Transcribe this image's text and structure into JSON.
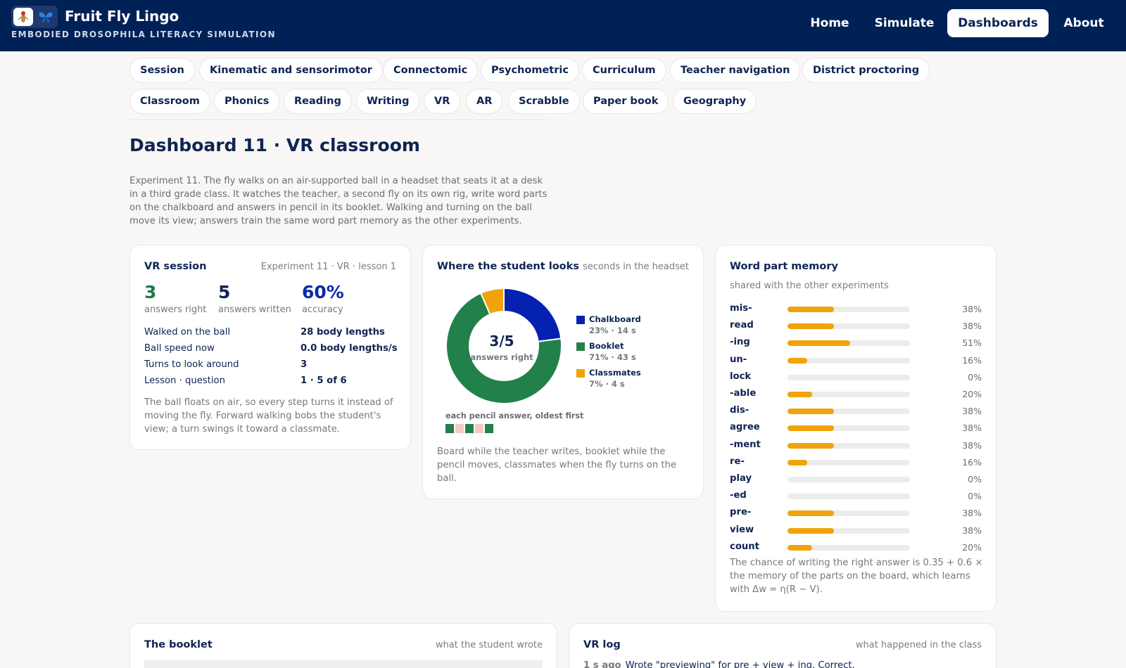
{
  "app": {
    "title": "Fruit Fly Lingo",
    "subtitle": "EMBODIED DROSOPHILA LITERACY SIMULATION"
  },
  "nav": [
    {
      "label": "Home",
      "active": false
    },
    {
      "label": "Simulate",
      "active": false
    },
    {
      "label": "Dashboards",
      "active": true
    },
    {
      "label": "About",
      "active": false
    }
  ],
  "dashboard_tabs_row1": [
    "Session",
    "Kinematic and sensorimotor",
    "Connectomic",
    "Psychometric",
    "Curriculum",
    "Teacher navigation",
    "District proctoring"
  ],
  "dashboard_tabs_row2": [
    "Classroom",
    "Phonics",
    "Reading",
    "Writing",
    "VR",
    "AR",
    "Scrabble",
    "Paper book",
    "Geography"
  ],
  "page": {
    "title": "Dashboard 11 · VR classroom",
    "intro": "Experiment 11. The fly walks on an air-supported ball in a headset that seats it at a desk in a third grade class. It watches the teacher, a second fly on its own rig, write word parts on the chalkboard and answers in pencil in its booklet. Walking and turning on the ball move its view; answers train the same word part memory as the other experiments."
  },
  "session": {
    "title": "VR session",
    "meta": "Experiment 11 · VR · lesson 1",
    "stats": [
      {
        "value": "3",
        "label": "answers right",
        "color": "#1e7a45"
      },
      {
        "value": "5",
        "label": "answers written",
        "color": "#0e2452"
      },
      {
        "value": "60%",
        "label": "accuracy",
        "color": "#0a2aa8"
      }
    ],
    "rows": [
      {
        "key": "Walked on the ball",
        "value": "28 body lengths"
      },
      {
        "key": "Ball speed now",
        "value": "0.0 body lengths/s"
      },
      {
        "key": "Turns to look around",
        "value": "3"
      },
      {
        "key": "Lesson · question",
        "value": "1 · 5 of 6"
      }
    ],
    "note": "The ball floats on air, so every step turns it instead of moving the fly. Forward walking bobs the student's view; a turn swings it toward a classmate."
  },
  "gaze": {
    "title": "Where the student looks",
    "meta": "seconds in the headset",
    "center_value": "3/5",
    "center_label": "answers right",
    "answers_caption": "each pencil answer, oldest first",
    "answers": [
      {
        "correct": true,
        "color": "#22804a"
      },
      {
        "correct": false,
        "color": "#f2cbc6"
      },
      {
        "correct": true,
        "color": "#22804a"
      },
      {
        "correct": false,
        "color": "#f2cbc6"
      },
      {
        "correct": true,
        "color": "#22804a"
      }
    ],
    "note": "Board while the teacher writes, booklet while the pencil moves, classmates when the fly turns on the ball."
  },
  "chart_data": {
    "type": "pie",
    "title": "Where the student looks",
    "subtitle": "seconds in the headset",
    "donut": true,
    "categories": [
      "Chalkboard",
      "Booklet",
      "Classmates"
    ],
    "values": [
      14,
      43,
      4
    ],
    "percent_labels": [
      "23% · 14 s",
      "71% · 43 s",
      "7% · 4 s"
    ],
    "colors": [
      "#0421b0",
      "#22804a",
      "#f0a30a"
    ],
    "legend_position": "right"
  },
  "memory": {
    "title": "Word part memory",
    "subtitle": "shared with the other experiments",
    "items": [
      {
        "label": "mis-",
        "value": 0.38,
        "pct": "38%"
      },
      {
        "label": "read",
        "value": 0.38,
        "pct": "38%"
      },
      {
        "label": "-ing",
        "value": 0.51,
        "pct": "51%"
      },
      {
        "label": "un-",
        "value": 0.16,
        "pct": "16%"
      },
      {
        "label": "lock",
        "value": 0.0,
        "pct": "0%"
      },
      {
        "label": "-able",
        "value": 0.2,
        "pct": "20%"
      },
      {
        "label": "dis-",
        "value": 0.38,
        "pct": "38%"
      },
      {
        "label": "agree",
        "value": 0.38,
        "pct": "38%"
      },
      {
        "label": "-ment",
        "value": 0.38,
        "pct": "38%"
      },
      {
        "label": "re-",
        "value": 0.16,
        "pct": "16%"
      },
      {
        "label": "play",
        "value": 0.0,
        "pct": "0%"
      },
      {
        "label": "-ed",
        "value": 0.0,
        "pct": "0%"
      },
      {
        "label": "pre-",
        "value": 0.38,
        "pct": "38%"
      },
      {
        "label": "view",
        "value": 0.38,
        "pct": "38%"
      },
      {
        "label": "count",
        "value": 0.2,
        "pct": "20%"
      }
    ],
    "note": "The chance of writing the right answer is 0.35 + 0.6 × the memory of the parts on the board, which learns with Δw = η(R − V)."
  },
  "booklet": {
    "title": "The booklet",
    "meta": "what the student wrote"
  },
  "vrlog": {
    "title": "VR log",
    "meta": "what happened in the class",
    "entries": [
      {
        "time": "1 s ago",
        "text": "Wrote \"previewing\" for pre + view + ing. Correct."
      }
    ]
  },
  "colors": {
    "header_bg": "#002156",
    "accent_blue": "#0421b0",
    "accent_green": "#22804a",
    "accent_amber": "#f0a30a"
  }
}
